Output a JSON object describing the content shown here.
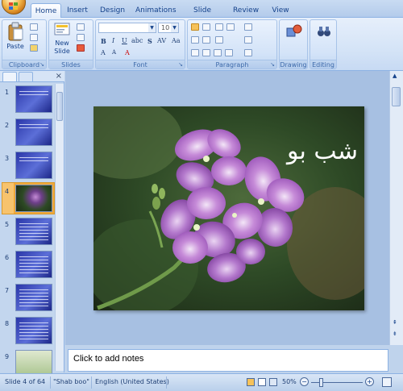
{
  "ribbon": {
    "tabs": [
      "Home",
      "Insert",
      "Design",
      "Animations",
      "Slide Show",
      "Review",
      "View"
    ],
    "groups": {
      "clipboard": "Clipboard",
      "slides": "Slides",
      "font": "Font",
      "paragraph": "Paragraph",
      "drawing": "Drawing",
      "editing": "Editing"
    },
    "paste_label": "Paste",
    "new_slide_label": "New Slide",
    "font_size_value": "10"
  },
  "slides_panel": {
    "thumbnails": [
      1,
      2,
      3,
      4,
      5,
      6,
      7,
      8,
      9
    ],
    "selected": 4
  },
  "slide": {
    "title_text": "شب بو"
  },
  "notes": {
    "placeholder": "Click to add notes"
  },
  "status_bar": {
    "slide_info": "Slide 4 of 64",
    "theme": "\"Shab boo\"",
    "language": "English (United States)",
    "zoom": "50%"
  },
  "colors": {
    "ribbon_text": "#15428b",
    "selection": "#f0a93a",
    "slide_title": "#ffffff"
  }
}
